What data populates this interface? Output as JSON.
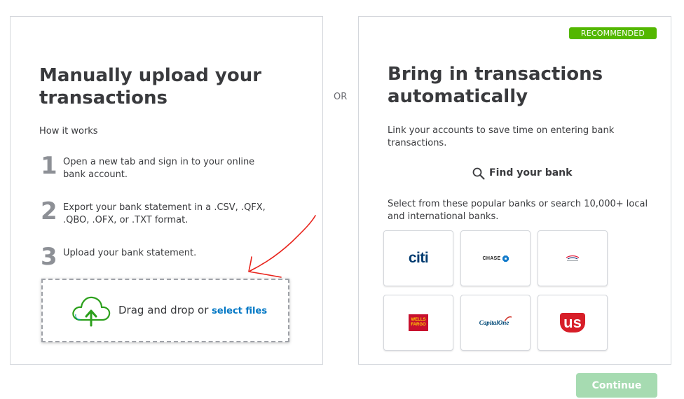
{
  "manual": {
    "title": "Manually upload your transactions",
    "how_it_works": "How it works",
    "steps": [
      {
        "number": "1",
        "text": "Open a new tab and sign in to your online bank account."
      },
      {
        "number": "2",
        "text": "Export your bank statement in a .CSV, .QFX, .QBO, .OFX, or .TXT format."
      },
      {
        "number": "3",
        "text": "Upload your bank statement."
      }
    ],
    "drop_zone": {
      "text": "Drag and drop or",
      "link": "select files",
      "icon": "cloud-upload-icon"
    }
  },
  "or_label": "OR",
  "automatic": {
    "badge": "RECOMMENDED",
    "title": "Bring in transactions automatically",
    "description": "Link your accounts to save time on entering bank transactions.",
    "find_bank": "Find your bank",
    "find_bank_icon": "search-icon",
    "popular_text": "Select from these popular banks or search 10,000+ local and international banks.",
    "banks": [
      {
        "name": "citi",
        "logo_text": "citi"
      },
      {
        "name": "chase",
        "logo_text": "CHASE"
      },
      {
        "name": "bank-of-america",
        "logo_text": ""
      },
      {
        "name": "wells-fargo",
        "logo_text": "WELLS FARGO"
      },
      {
        "name": "capital-one",
        "logo_text": "CapitalOne"
      },
      {
        "name": "us-bank",
        "logo_text": "us"
      }
    ]
  },
  "continue_label": "Continue",
  "colors": {
    "badge": "#53b700",
    "link": "#0077c5",
    "continue_disabled": "#a6dbb1",
    "upload_arrow": "#2ca01c",
    "annotation": "#e8231b"
  }
}
